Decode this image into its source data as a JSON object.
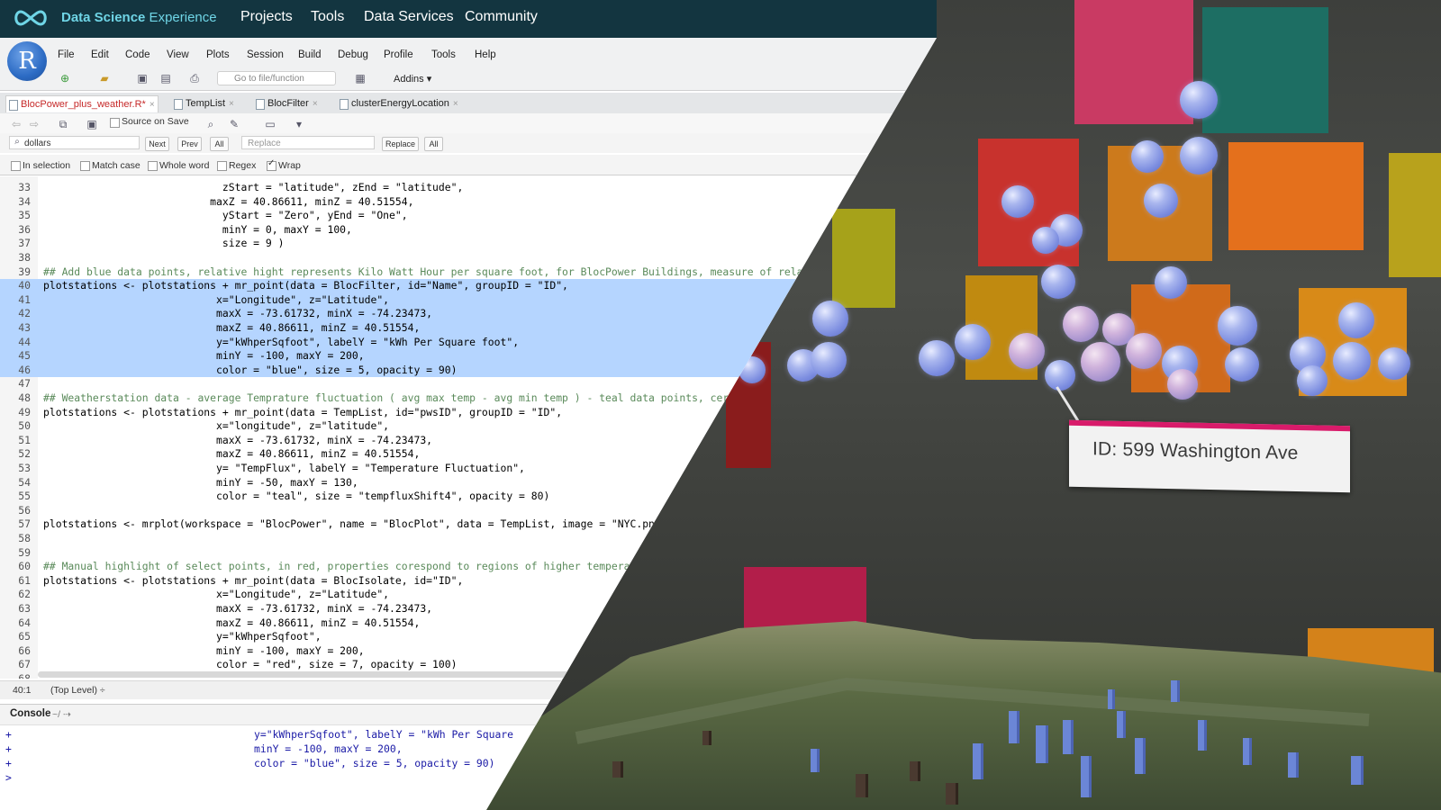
{
  "app": {
    "brand_bold": "Data Science",
    "brand_rest": " Experience",
    "nav": [
      "Projects",
      "Tools",
      "Data Services",
      "Community"
    ],
    "r_logo": "R"
  },
  "menubar": [
    "File",
    "Edit",
    "Code",
    "View",
    "Plots",
    "Session",
    "Build",
    "Debug",
    "Profile",
    "Tools",
    "Help"
  ],
  "toolbar": {
    "goto_placeholder": "Go to file/function",
    "addins_label": "Addins ▾"
  },
  "tabs": [
    {
      "label": "BlocPower_plus_weather.R*",
      "active": true
    },
    {
      "label": "TempList",
      "active": false
    },
    {
      "label": "BlocFilter",
      "active": false
    },
    {
      "label": "clusterEnergyLocation",
      "active": false
    }
  ],
  "editor_toolbar": {
    "source_on_save": "Source on Save"
  },
  "find": {
    "search_value": "dollars",
    "next": "Next",
    "prev": "Prev",
    "all": "All",
    "replace_placeholder": "Replace",
    "replace_btn": "Replace",
    "replace_all": "All",
    "options": [
      {
        "label": "In selection",
        "checked": false
      },
      {
        "label": "Match case",
        "checked": false
      },
      {
        "label": "Whole word",
        "checked": false
      },
      {
        "label": "Regex",
        "checked": false
      },
      {
        "label": "Wrap",
        "checked": true
      }
    ]
  },
  "code_lines": [
    {
      "n": "33",
      "t": "                             zStart = \"latitude\", zEnd = \"latitude\",",
      "sel": false
    },
    {
      "n": "34",
      "t": "                           maxZ = 40.86611, minZ = 40.51554,",
      "sel": false
    },
    {
      "n": "35",
      "t": "                             yStart = \"Zero\", yEnd = \"One\",",
      "sel": false
    },
    {
      "n": "36",
      "t": "                             minY = 0, maxY = 100,",
      "sel": false
    },
    {
      "n": "37",
      "t": "                             size = 9 )",
      "sel": false
    },
    {
      "n": "38",
      "t": "",
      "sel": false
    },
    {
      "n": "39",
      "t": "## Add blue data points, relative hight represents Kilo Watt Hour per square foot, for BlocPower Buildings, measure of relat",
      "sel": false,
      "comment": true
    },
    {
      "n": "40",
      "t": "plotstations <- plotstations + mr_point(data = BlocFilter, id=\"Name\", groupID = \"ID\",",
      "sel": true
    },
    {
      "n": "41",
      "t": "                            x=\"Longitude\", z=\"Latitude\",",
      "sel": true
    },
    {
      "n": "42",
      "t": "                            maxX = -73.61732, minX = -74.23473,",
      "sel": true
    },
    {
      "n": "43",
      "t": "                            maxZ = 40.86611, minZ = 40.51554,",
      "sel": true
    },
    {
      "n": "44",
      "t": "                            y=\"kWhperSqfoot\", labelY = \"kWh Per Square foot\",",
      "sel": true
    },
    {
      "n": "45",
      "t": "                            minY = -100, maxY = 200,",
      "sel": true
    },
    {
      "n": "46",
      "t": "                            color = \"blue\", size = 5, opacity = 90)",
      "sel": true
    },
    {
      "n": "47",
      "t": "",
      "sel": false
    },
    {
      "n": "48",
      "t": "## Weatherstation data - average Temprature fluctuation ( avg max temp - avg min temp ) - teal data points, cert",
      "sel": false,
      "comment": true
    },
    {
      "n": "49",
      "t": "plotstations <- plotstations + mr_point(data = TempList, id=\"pwsID\", groupID = \"ID\",",
      "sel": false
    },
    {
      "n": "50",
      "t": "                            x=\"longitude\", z=\"latitude\",",
      "sel": false
    },
    {
      "n": "51",
      "t": "                            maxX = -73.61732, minX = -74.23473,",
      "sel": false
    },
    {
      "n": "52",
      "t": "                            maxZ = 40.86611, minZ = 40.51554,",
      "sel": false
    },
    {
      "n": "53",
      "t": "                            y= \"TempFlux\", labelY = \"Temperature Fluctuation\",",
      "sel": false
    },
    {
      "n": "54",
      "t": "                            minY = -50, maxY = 130,",
      "sel": false
    },
    {
      "n": "55",
      "t": "                            color = \"teal\", size = \"tempfluxShift4\", opacity = 80)",
      "sel": false
    },
    {
      "n": "56",
      "t": "",
      "sel": false
    },
    {
      "n": "57",
      "t": "plotstations <- mrplot(workspace = \"BlocPower\", name = \"BlocPlot\", data = TempList, image = \"NYC.pn",
      "sel": false
    },
    {
      "n": "58",
      "t": "",
      "sel": false
    },
    {
      "n": "59",
      "t": "",
      "sel": false
    },
    {
      "n": "60",
      "t": "## Manual highlight of select points, in red, properties corespond to regions of higher tempera",
      "sel": false,
      "comment": true
    },
    {
      "n": "61",
      "t": "plotstations <- plotstations + mr_point(data = BlocIsolate, id=\"ID\",",
      "sel": false
    },
    {
      "n": "62",
      "t": "                            x=\"Longitude\", z=\"Latitude\",",
      "sel": false
    },
    {
      "n": "63",
      "t": "                            maxX = -73.61732, minX = -74.23473,",
      "sel": false
    },
    {
      "n": "64",
      "t": "                            maxZ = 40.86611, minZ = 40.51554,",
      "sel": false
    },
    {
      "n": "65",
      "t": "                            y=\"kWhperSqfoot\",",
      "sel": false
    },
    {
      "n": "66",
      "t": "                            minY = -100, maxY = 200,",
      "sel": false
    },
    {
      "n": "67",
      "t": "                            color = \"red\", size = 7, opacity = 100)",
      "sel": false
    },
    {
      "n": "68",
      "t": "",
      "sel": false
    }
  ],
  "status": {
    "position": "40:1",
    "scope": "(Top Level) ÷"
  },
  "console": {
    "title": "Console",
    "path": "~/",
    "lines": [
      {
        "prompt": "+",
        "text": "y=\"kWhperSqfoot\", labelY = \"kWh Per Square"
      },
      {
        "prompt": "+",
        "text": "minY = -100, maxY = 200,"
      },
      {
        "prompt": "+",
        "text": "color = \"blue\", size = 5, opacity = 90)"
      },
      {
        "prompt": ">",
        "text": ""
      }
    ]
  },
  "vr": {
    "tooltip": "ID: 599 Washington Ave"
  },
  "colors": {
    "topbar": "#133540",
    "brand": "#6fd5e6",
    "selection": "#b5d5ff",
    "active_tab_text": "#c62828",
    "tooltip_accent": "#d81b6a"
  }
}
